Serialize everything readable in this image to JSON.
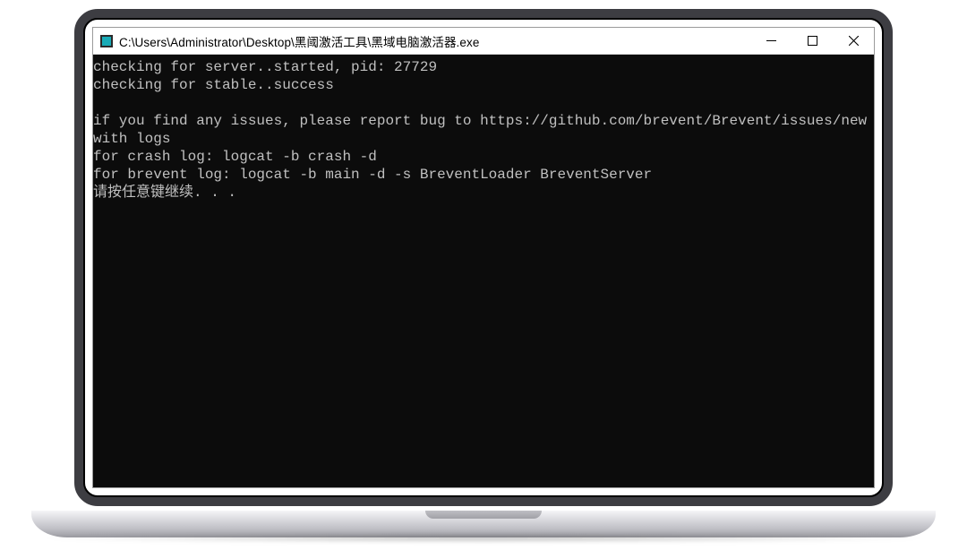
{
  "window": {
    "title": "C:\\Users\\Administrator\\Desktop\\黑阈激活工具\\黑域电脑激活器.exe"
  },
  "console": {
    "lines": [
      "checking for server..started, pid: 27729",
      "checking for stable..success",
      "",
      "if you find any issues, please report bug to https://github.com/brevent/Brevent/issues/new with logs",
      "for crash log: logcat -b crash -d",
      "for brevent log: logcat -b main -d -s BreventLoader BreventServer",
      "请按任意键继续. . ."
    ]
  }
}
